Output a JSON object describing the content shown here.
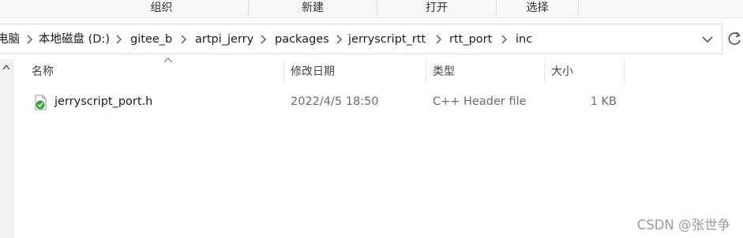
{
  "ribbon": {
    "groups": [
      "组织",
      "新建",
      "打开",
      "选择"
    ]
  },
  "address": {
    "crumbs": [
      "电脑",
      "本地磁盘 (D:)",
      "gitee_b",
      "artpi_jerry",
      "packages",
      "jerryscript_rtt",
      "rtt_port",
      "inc"
    ]
  },
  "columns": {
    "name": "名称",
    "modified": "修改日期",
    "type": "类型",
    "size": "大小"
  },
  "files": [
    {
      "name": "jerryscript_port.h",
      "modified": "2022/4/5 18:50",
      "type": "C++ Header file",
      "size": "1 KB",
      "icon": "c-header-file-icon"
    }
  ],
  "watermark": "CSDN @张世争",
  "colors": {
    "ribbon_bg": "#f8f8f8",
    "file_icon_green": "#3aa53a",
    "watermark": "#9a9a9a"
  }
}
